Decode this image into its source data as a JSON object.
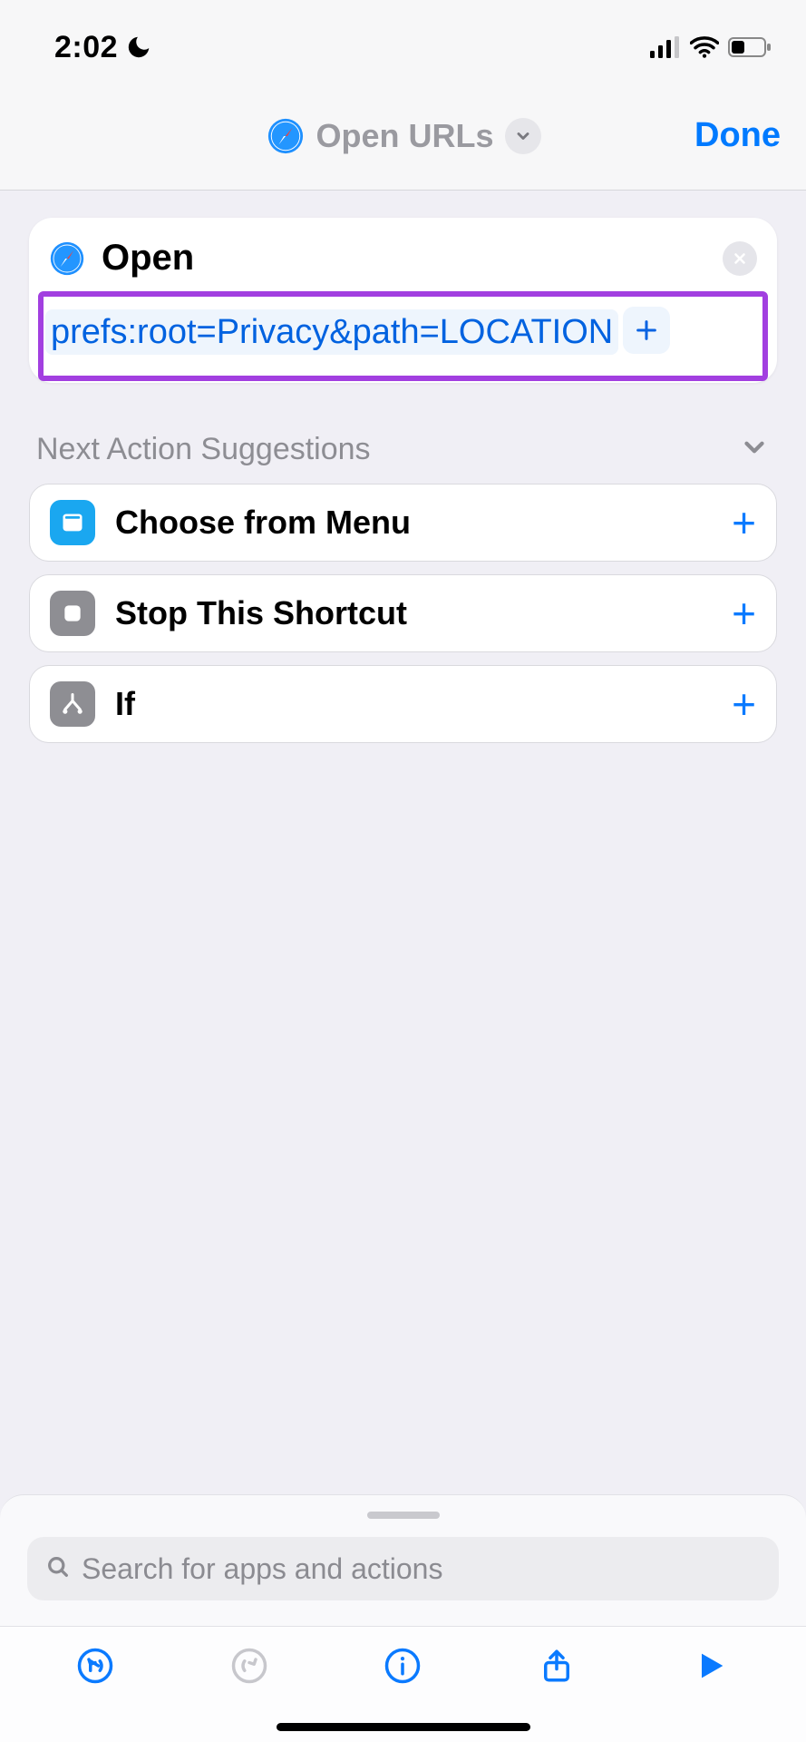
{
  "status": {
    "time": "2:02"
  },
  "header": {
    "title": "Open URLs",
    "done_label": "Done"
  },
  "action": {
    "title": "Open",
    "url_text": "prefs:root=Privacy&path=LOCATION"
  },
  "suggestions": {
    "header": "Next Action Suggestions",
    "items": [
      {
        "label": "Choose from Menu",
        "icon": "menu-card-icon",
        "color": "blue"
      },
      {
        "label": "Stop This Shortcut",
        "icon": "stop-icon",
        "color": "gray1"
      },
      {
        "label": "If",
        "icon": "branch-icon",
        "color": "gray2"
      }
    ]
  },
  "search": {
    "placeholder": "Search for apps and actions"
  }
}
